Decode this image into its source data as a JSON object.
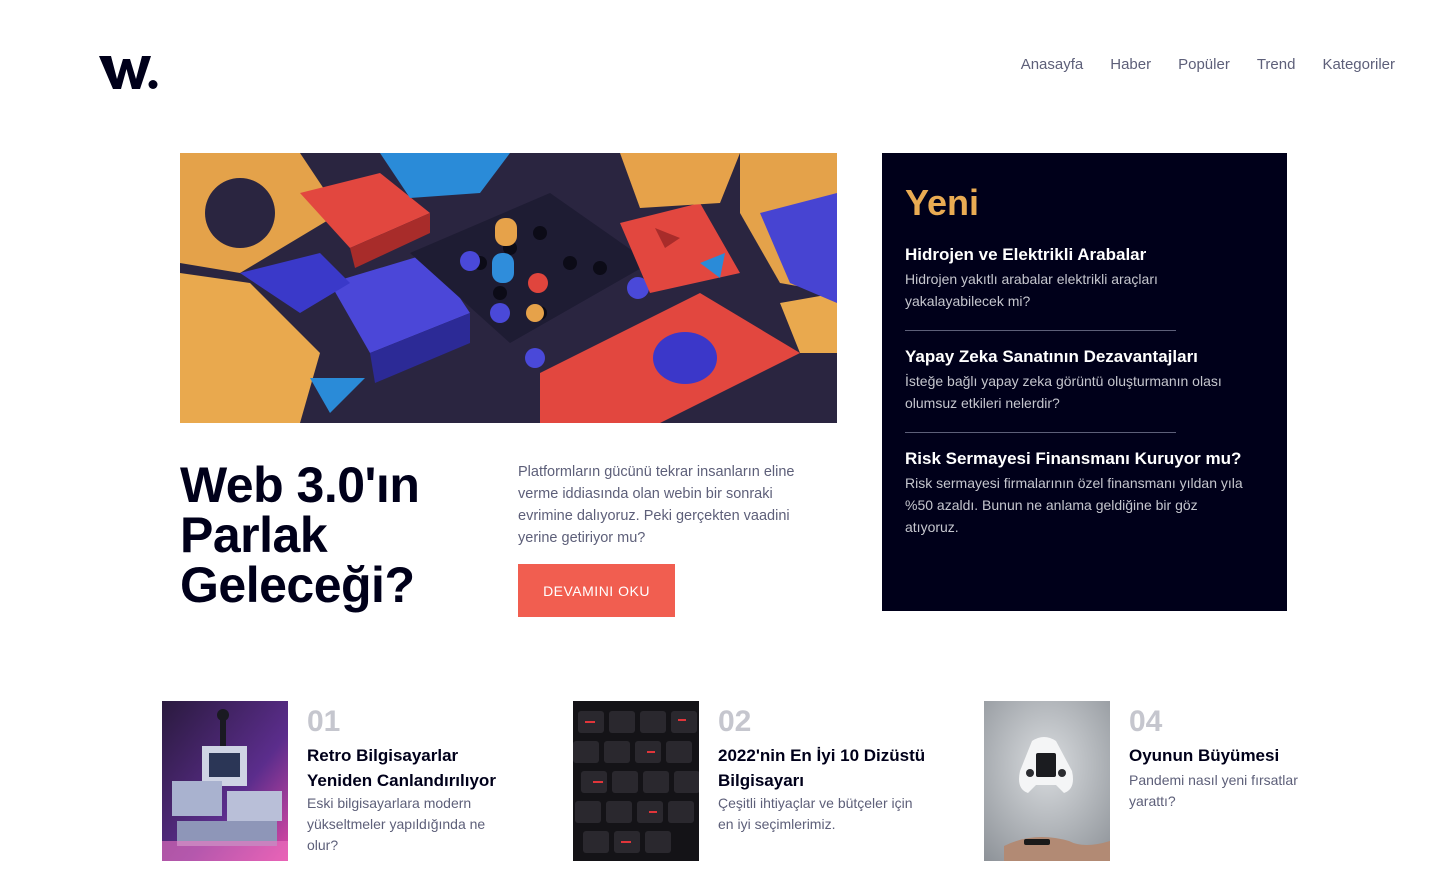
{
  "brand": {
    "logo_text": "W."
  },
  "nav": {
    "items": [
      "Anasayfa",
      "Haber",
      "Popüler",
      "Trend",
      "Kategoriler"
    ]
  },
  "hero": {
    "image_icon": "abstract-blocks-image",
    "title": "Web 3.0'ın Parlak Geleceği?",
    "description": "Platformların gücünü tekrar insanların eline verme iddiasında olan webin bir sonraki evrimine dalıyoruz. Peki gerçekten vaadini yerine getiriyor mu?",
    "button_label": "DEVAMINI OKU"
  },
  "new_panel": {
    "title": "Yeni",
    "items": [
      {
        "title": "Hidrojen ve Elektrikli Arabalar",
        "description": "Hidrojen yakıtlı arabalar elektrikli araçları yakalayabilecek mi?"
      },
      {
        "title": "Yapay Zeka Sanatının Dezavantajları",
        "description": "İsteğe bağlı yapay zeka görüntü oluşturmanın olası olumsuz etkileri nelerdir?"
      },
      {
        "title": "Risk Sermayesi Finansmanı Kuruyor mu?",
        "description": "Risk sermayesi firmalarının özel finansmanı yıldan yıla %50 azaldı. Bunun ne anlama geldiğine bir göz atıyoruz."
      }
    ]
  },
  "cards": [
    {
      "number": "01",
      "title": "Retro Bilgisayarlar Yeniden Canlandırılıyor",
      "description": "Eski bilgisayarlara modern yükseltmeler yapıldığında ne olur?",
      "image_icon": "retro-computer-image"
    },
    {
      "number": "02",
      "title": "2022'nin En İyi 10 Dizüstü Bilgisayarı",
      "description": "Çeşitli ihtiyaçlar ve bütçeler için en iyi seçimlerimiz.",
      "image_icon": "laptop-keyboard-image"
    },
    {
      "number": "04",
      "title": "Oyunun Büyümesi",
      "description": "Pandemi nasıl yeni fırsatlar yarattı?",
      "image_icon": "game-controller-image"
    }
  ],
  "colors": {
    "dark": "#00001a",
    "accent_red": "#f15e50",
    "accent_orange": "#e9ab53",
    "grayish_blue": "#5d5f79",
    "light_gray": "#c5c6ce"
  }
}
